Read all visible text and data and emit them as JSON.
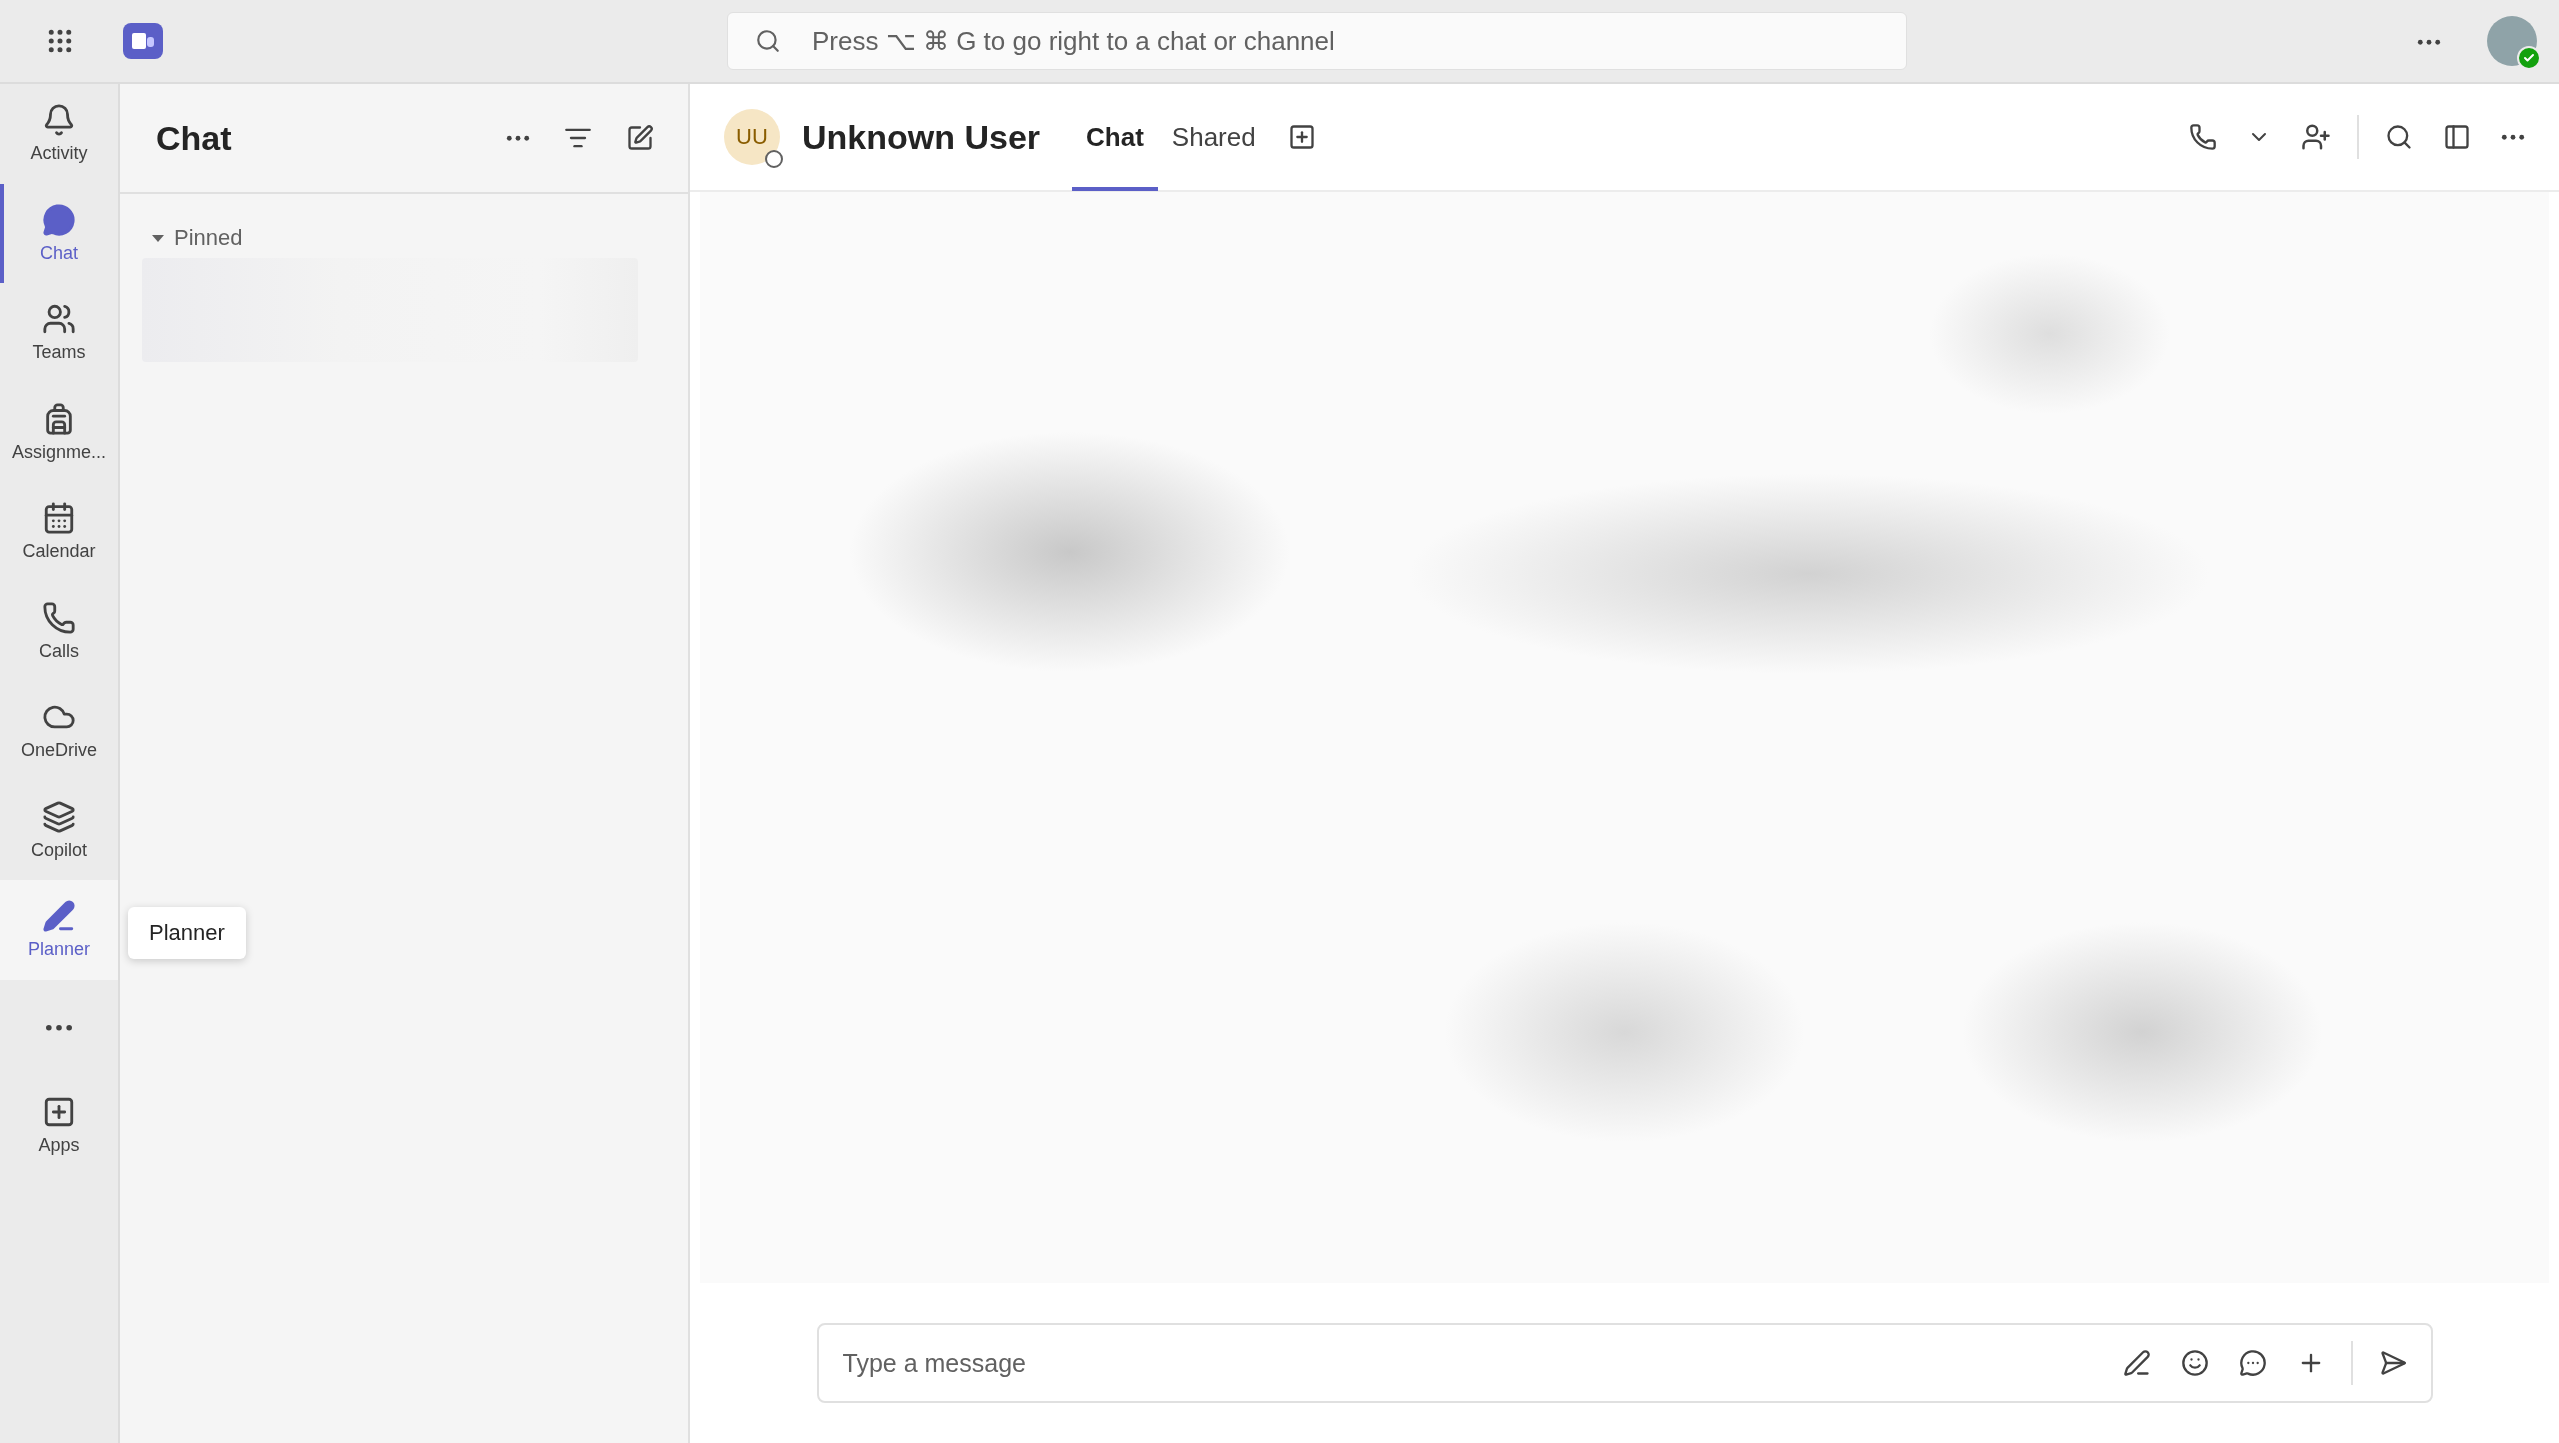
{
  "top_bar": {
    "search": {
      "placeholder": "Press ⌥ ⌘ G to go right to a chat or channel"
    }
  },
  "rail": {
    "items": [
      {
        "label": "Activity",
        "selected": false,
        "hovered": false
      },
      {
        "label": "Chat",
        "selected": true,
        "hovered": false
      },
      {
        "label": "Teams",
        "selected": false,
        "hovered": false
      },
      {
        "label": "Assignme...",
        "selected": false,
        "hovered": false
      },
      {
        "label": "Calendar",
        "selected": false,
        "hovered": false
      },
      {
        "label": "Calls",
        "selected": false,
        "hovered": false
      },
      {
        "label": "OneDrive",
        "selected": false,
        "hovered": false
      },
      {
        "label": "Copilot",
        "selected": false,
        "hovered": false
      },
      {
        "label": "Planner",
        "selected": false,
        "hovered": true
      }
    ],
    "apps_label": "Apps",
    "tooltip": "Planner"
  },
  "chat_list": {
    "title": "Chat",
    "sections": [
      {
        "label": "Pinned",
        "expanded": true
      }
    ]
  },
  "conversation": {
    "avatar_initials": "UU",
    "name": "Unknown User",
    "tabs": [
      {
        "label": "Chat",
        "selected": true
      },
      {
        "label": "Shared",
        "selected": false
      }
    ]
  },
  "compose": {
    "placeholder": "Type a message"
  }
}
